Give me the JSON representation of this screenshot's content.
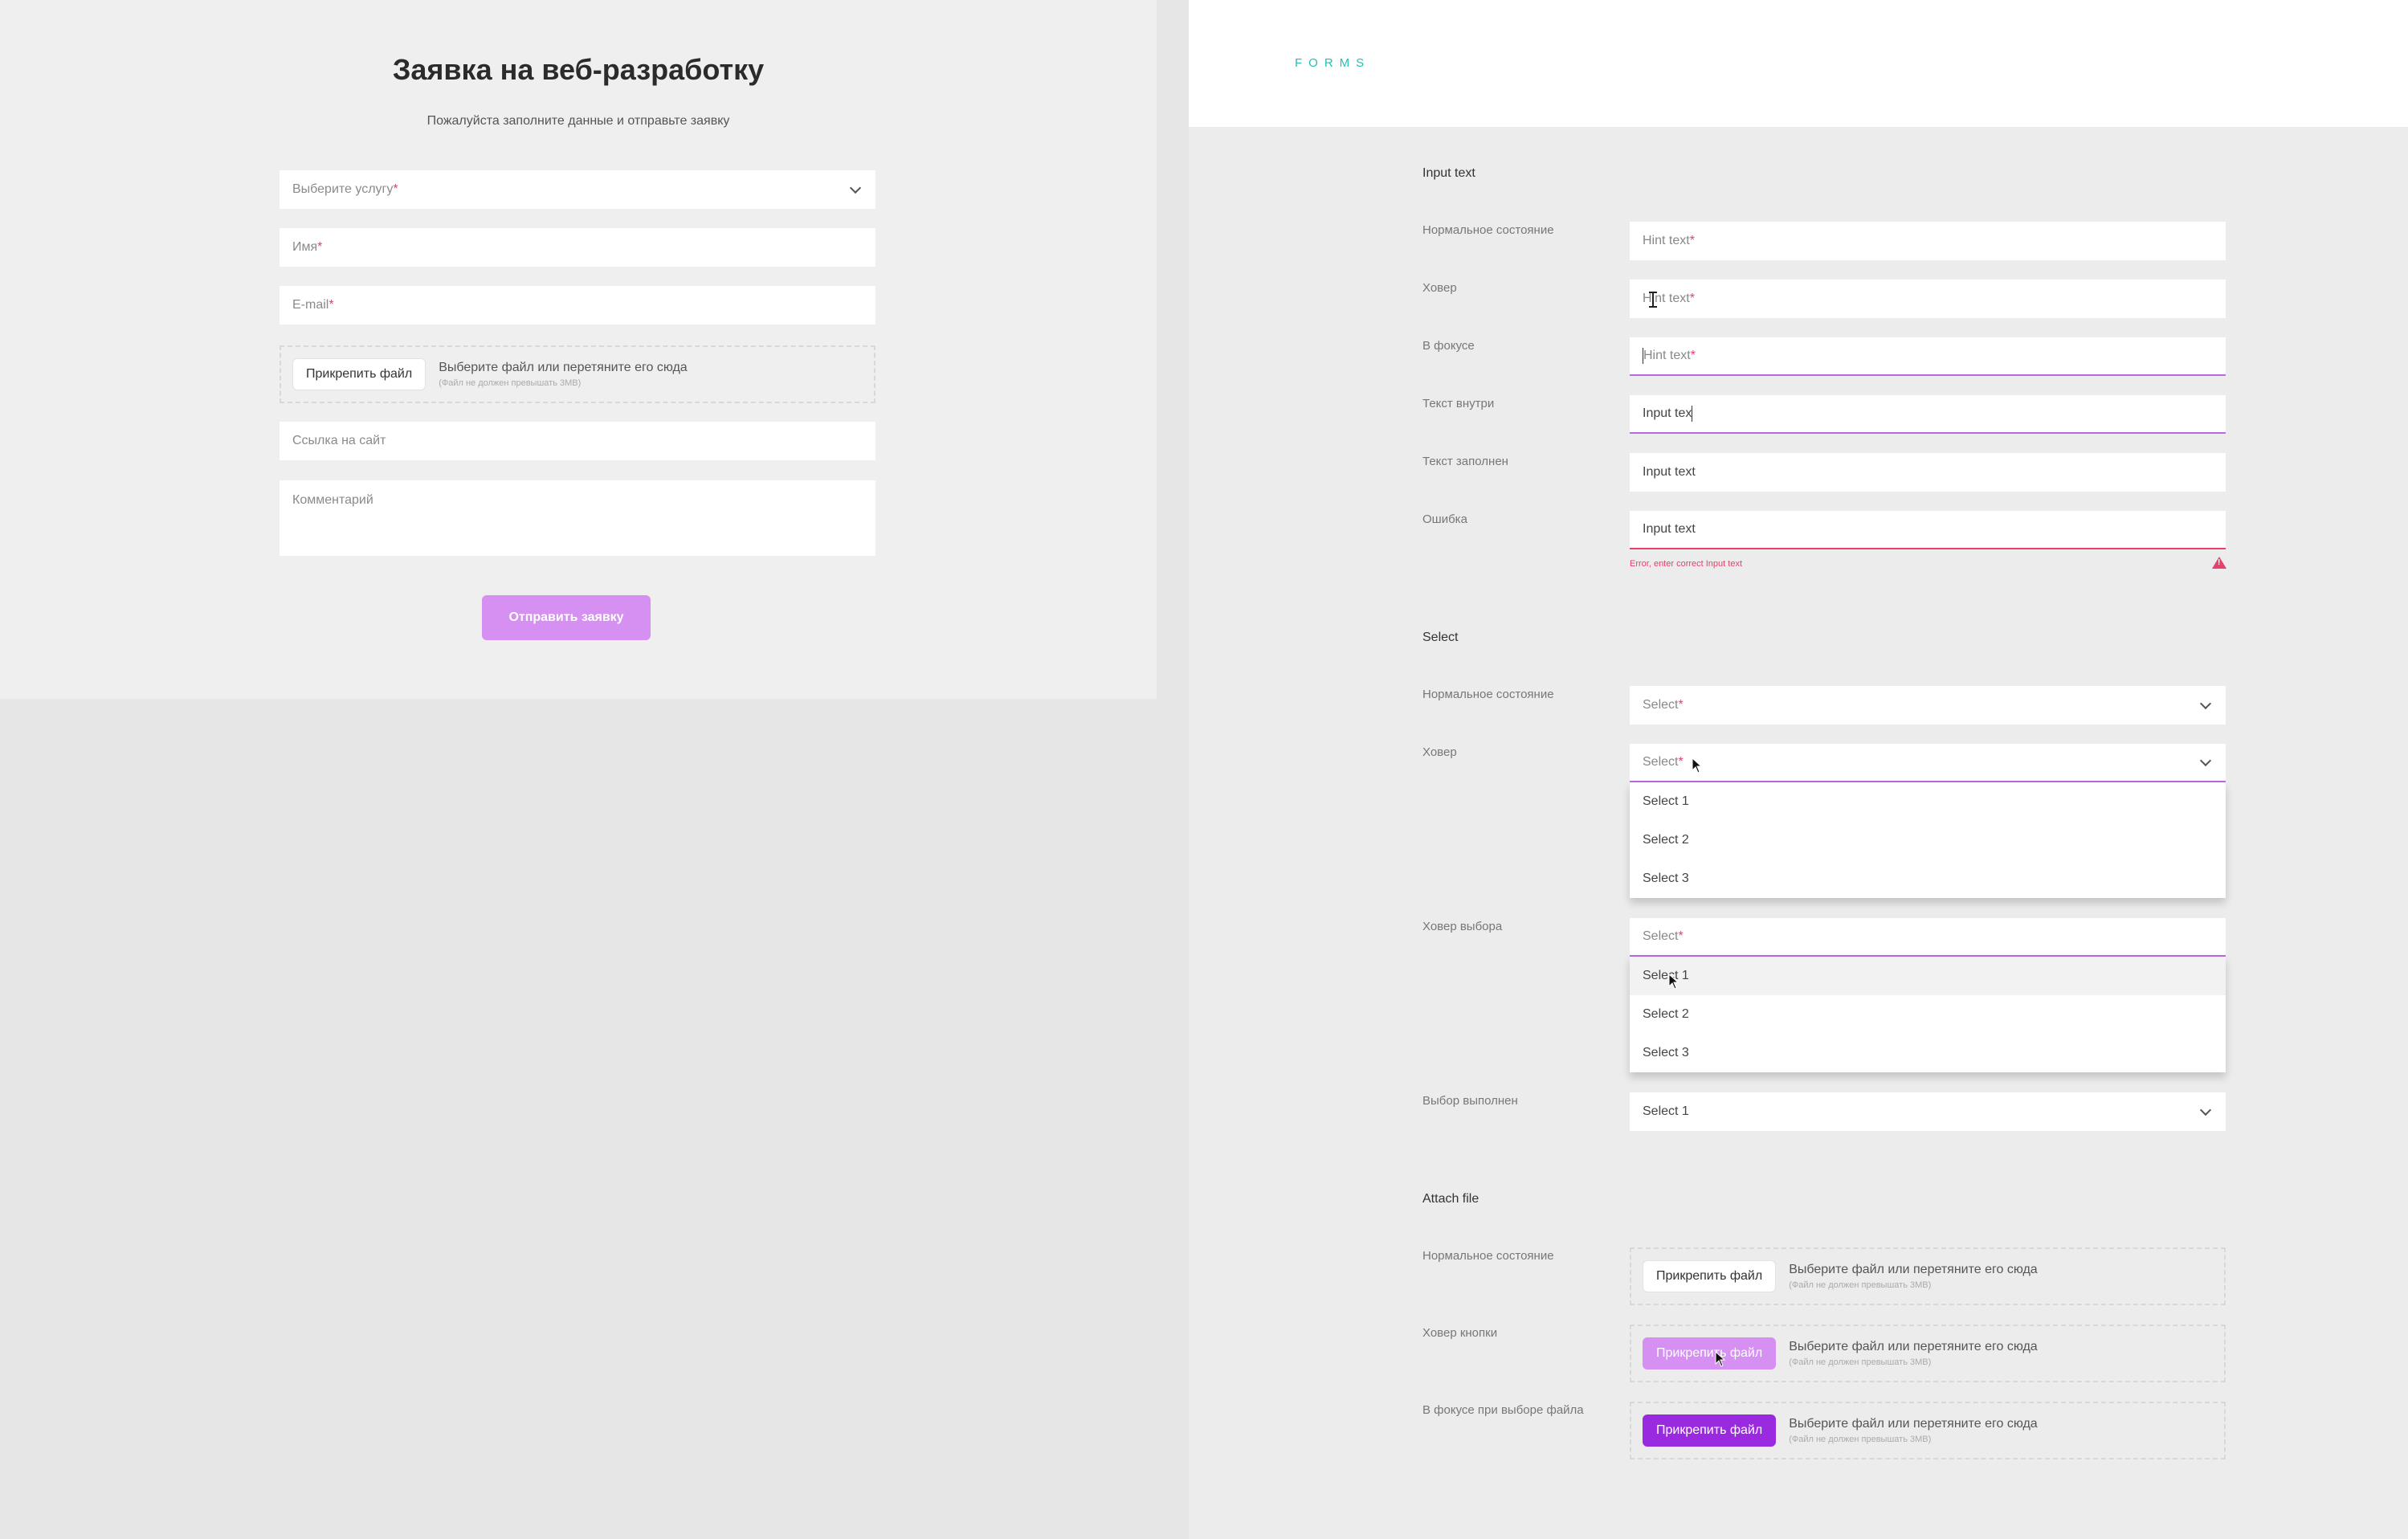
{
  "left_form": {
    "title": "Заявка на веб-разработку",
    "subtitle": "Пожалуйста заполните данные и отправьте заявку",
    "service_placeholder": "Выберите услугу",
    "name_placeholder": "Имя",
    "email_placeholder": "E-mail",
    "required_mark": "*",
    "attach_button": "Прикрепить файл",
    "attach_text": "Выберите файл или перетяните его сюда",
    "attach_hint": "(Файл не должен превышать 3MB)",
    "site_placeholder": "Ссылка на сайт",
    "comment_placeholder": "Комментарий",
    "submit_label": "Отправить заявку"
  },
  "guide": {
    "header_label": "FORMS",
    "input_section": {
      "title": "Input text",
      "rows": [
        {
          "label": "Нормальное состояние",
          "value": "Hint text"
        },
        {
          "label": "Ховер",
          "value": "Hint text"
        },
        {
          "label": "В фокусе",
          "value": "Hint text"
        },
        {
          "label": "Текст внутри",
          "value": "Input tex"
        },
        {
          "label": "Текст заполнен",
          "value": "Input text"
        },
        {
          "label": "Ошибка",
          "value": "Input text"
        }
      ],
      "error_message": "Error, enter correct Input text"
    },
    "select_section": {
      "title": "Select",
      "rows": [
        {
          "label": "Нормальное состояние",
          "value": "Select"
        },
        {
          "label": "Ховер",
          "value": "Select"
        },
        {
          "label": "Ховер выбора",
          "value": "Select"
        },
        {
          "label": "Выбор выполнен",
          "value": "Select 1"
        }
      ],
      "options": [
        "Select 1",
        "Select 2",
        "Select 3"
      ]
    },
    "attach_section": {
      "title": "Attach file",
      "rows": [
        {
          "label": "Нормальное состояние"
        },
        {
          "label": "Ховер кнопки"
        },
        {
          "label": "В фокусе при выборе файла"
        }
      ],
      "button_label": "Прикрепить файл",
      "text": "Выберите файл или перетяните его сюда",
      "hint": "(Файл не должен превышать 3MB)"
    }
  },
  "colors": {
    "accent": "#d590f2",
    "accent_dark": "#9a2ae0",
    "error": "#e5416a",
    "teal": "#26c0b2"
  }
}
